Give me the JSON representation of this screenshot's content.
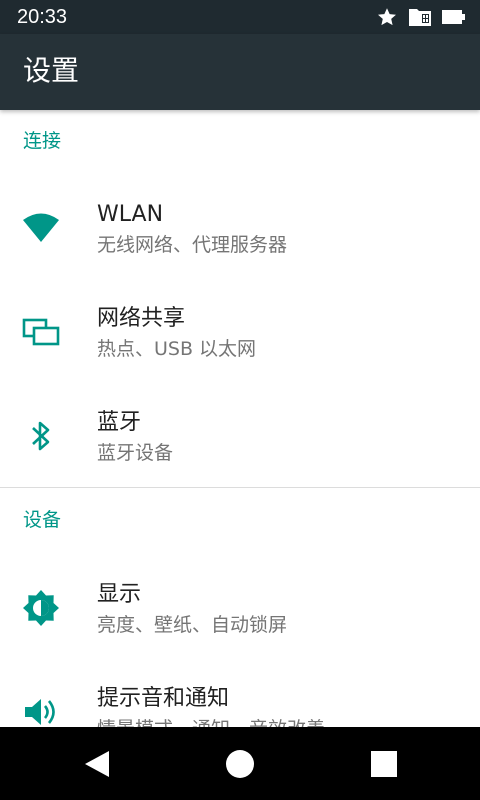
{
  "status_bar": {
    "time": "20:33",
    "icons": [
      "star-icon",
      "sim-card-icon",
      "battery-icon"
    ]
  },
  "app_bar": {
    "title": "设置"
  },
  "sections": [
    {
      "header": "连接",
      "items": [
        {
          "title": "WLAN",
          "summary": "无线网络、代理服务器",
          "icon": "wifi-icon"
        },
        {
          "title": "网络共享",
          "summary": "热点、USB 以太网",
          "icon": "tethering-icon"
        },
        {
          "title": "蓝牙",
          "summary": "蓝牙设备",
          "icon": "bluetooth-icon"
        }
      ]
    },
    {
      "header": "设备",
      "items": [
        {
          "title": "显示",
          "summary": "亮度、壁纸、自动锁屏",
          "icon": "brightness-icon"
        },
        {
          "title": "提示音和通知",
          "summary": "情景模式、通知、音效改善",
          "icon": "volume-icon"
        }
      ]
    }
  ],
  "nav_bar": {
    "buttons": [
      "back-icon",
      "home-icon",
      "recents-icon"
    ]
  },
  "colors": {
    "accent": "#009688",
    "app_bar": "#263238",
    "status_bar": "#1f2a30",
    "title_text": "#212121",
    "summary_text": "#757575"
  }
}
